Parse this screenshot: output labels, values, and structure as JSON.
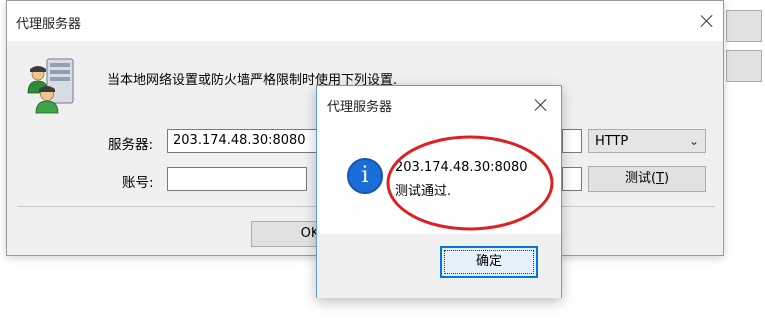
{
  "main_window": {
    "title": "代理服务器",
    "description": "当本地网络设置或防火墙严格限制时使用下列设置.",
    "server_label": "服务器:",
    "server_value": "203.174.48.30:8080",
    "account_label": "账号:",
    "account_value": "",
    "proxy_type": "HTTP",
    "test_button": "测试(T)",
    "test_button_prefix": "测试(",
    "test_button_hotkey": "T",
    "test_button_suffix": ")",
    "ok_button": "OK"
  },
  "message_box": {
    "title": "代理服务器",
    "line1": "203.174.48.30:8080",
    "line2": "测试通过.",
    "confirm_button": "确定"
  },
  "icons": {
    "main_app": "proxy-server-users-icon",
    "message": "info-icon",
    "close": "close-icon"
  },
  "colors": {
    "info_blue": "#1a6fd6",
    "highlight_red": "#e02020",
    "focus_blue": "#0078d7"
  }
}
